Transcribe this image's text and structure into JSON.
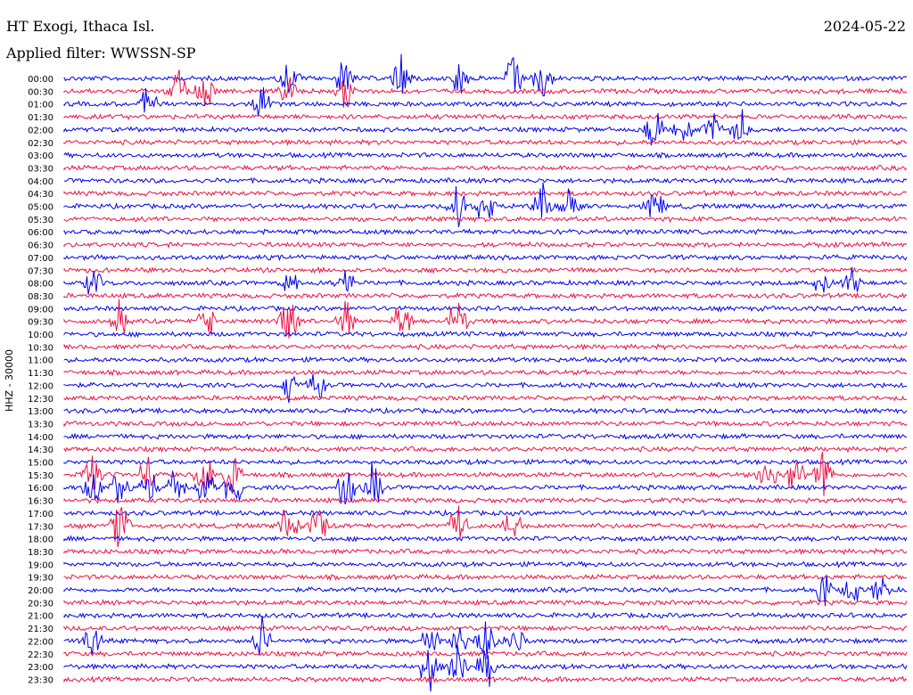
{
  "header": {
    "station": "HT Exogi, Ithaca Isl.",
    "filter": "Applied filter: WWSSN-SP",
    "date": "2024-05-22"
  },
  "channel_label": "HHZ - 30000",
  "colors": {
    "trace_a": "#0000ee",
    "trace_b": "#ee1144"
  },
  "chart_data": {
    "type": "line",
    "title": "HT Exogi, Ithaca Isl.",
    "subtitle": "Applied filter: WWSSN-SP",
    "ylabel": "HHZ - 30000",
    "row_labels": [
      "00:00",
      "00:30",
      "01:00",
      "01:30",
      "02:00",
      "02:30",
      "03:00",
      "03:30",
      "04:00",
      "04:30",
      "05:00",
      "05:30",
      "06:00",
      "06:30",
      "07:00",
      "07:30",
      "08:00",
      "08:30",
      "09:00",
      "09:30",
      "10:00",
      "10:30",
      "11:00",
      "11:30",
      "12:00",
      "12:30",
      "13:00",
      "13:30",
      "14:00",
      "14:30",
      "15:00",
      "15:30",
      "16:00",
      "16:30",
      "17:00",
      "17:30",
      "18:00",
      "18:30",
      "19:00",
      "19:30",
      "20:00",
      "20:30",
      "21:00",
      "21:30",
      "22:00",
      "22:30",
      "23:00",
      "23:30"
    ],
    "row_colors_cycle": [
      "blue",
      "red"
    ],
    "row_duration_minutes": 30,
    "bursts": [
      {
        "row": "00:00",
        "at_min": [
          8,
          10,
          12,
          14,
          16,
          17
        ],
        "strength": 3
      },
      {
        "row": "00:30",
        "at_min": [
          4,
          5,
          8,
          10
        ],
        "strength": 3
      },
      {
        "row": "01:00",
        "at_min": [
          3,
          7
        ],
        "strength": 2
      },
      {
        "row": "02:00",
        "at_min": [
          21,
          22,
          23,
          24
        ],
        "strength": 3
      },
      {
        "row": "05:00",
        "at_min": [
          14,
          15,
          17,
          18,
          21
        ],
        "strength": 3
      },
      {
        "row": "08:00",
        "at_min": [
          1,
          8,
          10,
          27,
          28
        ],
        "strength": 2
      },
      {
        "row": "09:30",
        "at_min": [
          2,
          5,
          8,
          10,
          12,
          14
        ],
        "strength": 3
      },
      {
        "row": "12:00",
        "at_min": [
          8,
          9
        ],
        "strength": 2
      },
      {
        "row": "15:30",
        "at_min": [
          1,
          3,
          5,
          6,
          25,
          26,
          27
        ],
        "strength": 3
      },
      {
        "row": "16:00",
        "at_min": [
          1,
          2,
          3,
          4,
          5,
          6,
          10,
          11
        ],
        "strength": 3
      },
      {
        "row": "17:30",
        "at_min": [
          2,
          8,
          9,
          14,
          16
        ],
        "strength": 3
      },
      {
        "row": "20:00",
        "at_min": [
          27,
          28,
          29
        ],
        "strength": 2
      },
      {
        "row": "22:00",
        "at_min": [
          1,
          7,
          13,
          14,
          15,
          16
        ],
        "strength": 3
      },
      {
        "row": "23:00",
        "at_min": [
          13,
          14,
          15
        ],
        "strength": 3
      }
    ]
  }
}
